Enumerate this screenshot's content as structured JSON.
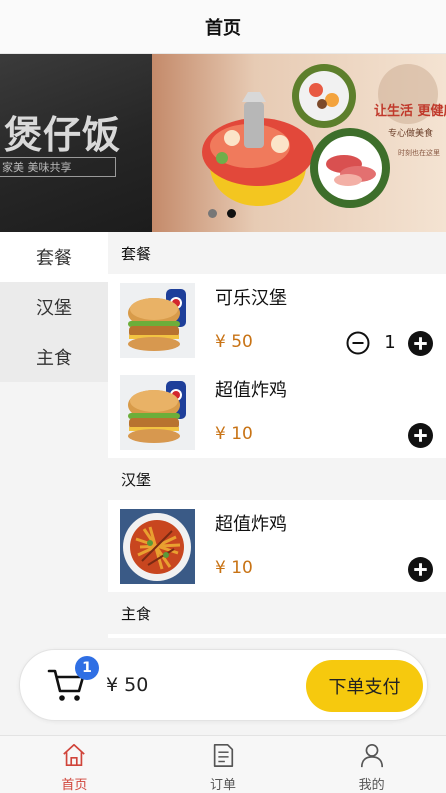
{
  "header": {
    "title": "首页"
  },
  "banner": {
    "left_slide": {
      "title": "煲仔饭",
      "subtitle": "家美  美味共享"
    },
    "right_slide": {
      "title": "让生活 更健康",
      "subtitle": "专心做美食",
      "subtitle2": "时刻也在这里"
    },
    "active_dot": 1
  },
  "categories": [
    {
      "label": "套餐",
      "active": true
    },
    {
      "label": "汉堡",
      "active": false
    },
    {
      "label": "主食",
      "active": false
    }
  ],
  "sections": [
    {
      "title": "套餐",
      "items": [
        {
          "name": "可乐汉堡",
          "price": "¥ 50",
          "qty": "1",
          "image": "burger-cola"
        },
        {
          "name": "超值炸鸡",
          "price": "¥ 10",
          "qty": "",
          "image": "burger-cola"
        }
      ]
    },
    {
      "title": "汉堡",
      "items": [
        {
          "name": "超值炸鸡",
          "price": "¥ 10",
          "qty": "",
          "image": "fried-strips"
        }
      ]
    },
    {
      "title": "主食",
      "items": []
    }
  ],
  "cart": {
    "badge": "1",
    "total": "¥ 50",
    "pay_label": "下单支付"
  },
  "tabs": [
    {
      "label": "首页",
      "icon": "home-icon",
      "active": true
    },
    {
      "label": "订单",
      "icon": "order-icon",
      "active": false
    },
    {
      "label": "我的",
      "icon": "user-icon",
      "active": false
    }
  ],
  "colors": {
    "accent": "#f6c90e",
    "price": "#c87315",
    "active_tab": "#d0443a",
    "badge": "#2f6fe4"
  }
}
